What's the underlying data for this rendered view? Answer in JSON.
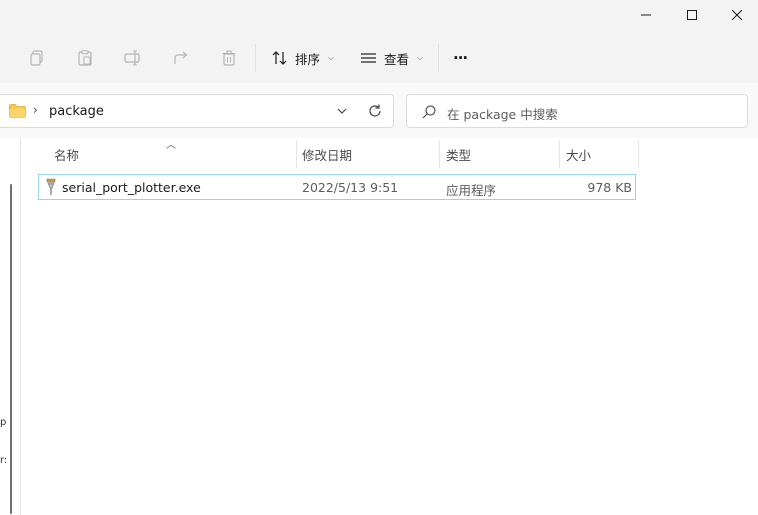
{
  "window": {
    "controls": {
      "minimize": "–",
      "maximize": "□",
      "close": "×"
    }
  },
  "toolbar": {
    "icons": [
      "copy-icon",
      "paste-icon",
      "rename-icon",
      "share-icon",
      "delete-icon"
    ],
    "sort_label": "排序",
    "view_label": "查看",
    "more_label": "···"
  },
  "address": {
    "breadcrumb": [
      "package"
    ],
    "search_placeholder": "在 package 中搜索"
  },
  "columns": [
    "名称",
    "修改日期",
    "类型",
    "大小"
  ],
  "files": [
    {
      "name": "serial_port_plotter.exe",
      "modified": "2022/5/13 9:51",
      "type": "应用程序",
      "size": "978 KB",
      "icon": "exe-app-icon"
    }
  ],
  "nav_fragments": [
    "p",
    "r:"
  ],
  "colors": {
    "selection_border": "#99d1f1",
    "folder": "#f8c84a"
  }
}
